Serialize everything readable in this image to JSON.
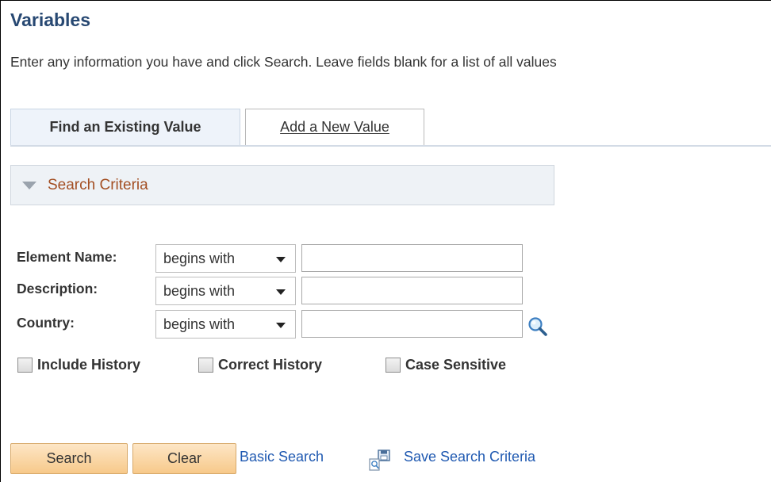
{
  "page": {
    "title": "Variables",
    "instructions": "Enter any information you have and click Search. Leave fields blank for a list of all values"
  },
  "tabs": [
    {
      "label": "Find an Existing Value",
      "active": true
    },
    {
      "label": "Add a New Value",
      "active": false
    }
  ],
  "search_criteria": {
    "header": "Search Criteria",
    "icon": "collapse-triangle-icon"
  },
  "fields": [
    {
      "label": "Element Name:",
      "operator": "begins with",
      "value": ""
    },
    {
      "label": "Description:",
      "operator": "begins with",
      "value": ""
    },
    {
      "label": "Country:",
      "operator": "begins with",
      "value": "",
      "lookup_icon": "magnifier-lookup-icon"
    }
  ],
  "checkboxes": [
    {
      "label": "Include History",
      "checked": false
    },
    {
      "label": "Correct History",
      "checked": false
    },
    {
      "label": "Case Sensitive",
      "checked": false
    }
  ],
  "actions": {
    "search_label": "Search",
    "clear_label": "Clear",
    "basic_search_label": "Basic Search",
    "save_criteria_label": "Save Search Criteria",
    "save_icon": "save-search-icon"
  },
  "colors": {
    "title": "#274872",
    "criteria_header_text": "#a34f23",
    "link": "#1f59b1",
    "button_fill": "#f7c98a"
  }
}
